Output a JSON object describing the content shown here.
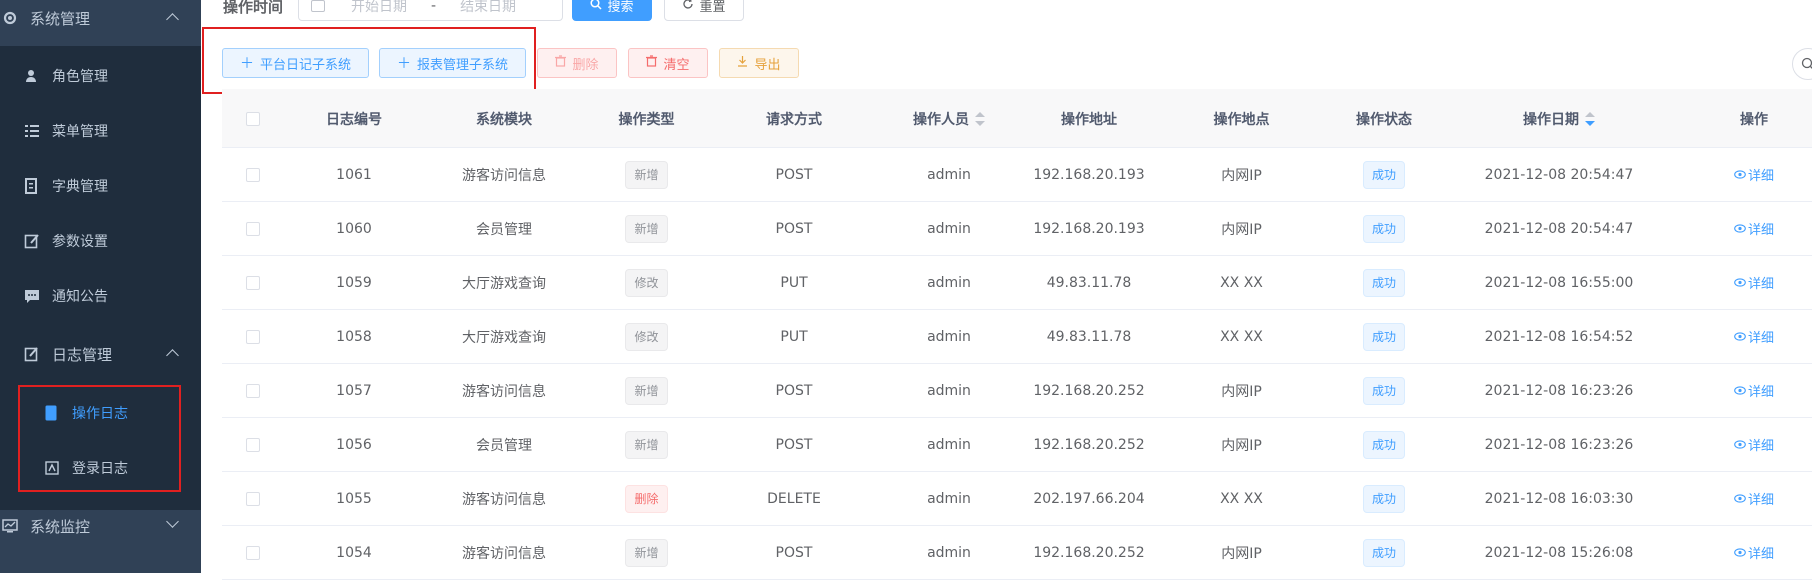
{
  "sidebar": {
    "system_label": "系统管理",
    "items": [
      {
        "label": "角色管理",
        "icon": "user-icon"
      },
      {
        "label": "菜单管理",
        "icon": "tree-table-icon"
      },
      {
        "label": "字典管理",
        "icon": "dict-icon"
      },
      {
        "label": "参数设置",
        "icon": "edit-icon"
      },
      {
        "label": "通知公告",
        "icon": "message-icon"
      }
    ],
    "log_menu_label": "日志管理",
    "log_items": [
      {
        "label": "操作日志",
        "active": true
      },
      {
        "label": "登录日志",
        "active": false
      }
    ],
    "monitor_label": "系统监控",
    "colors": {
      "bg": "#304156",
      "sub_bg": "#1f2d3d",
      "text": "#bfcbd9",
      "active": "#409eff"
    }
  },
  "search": {
    "label": "操作时间",
    "start_placeholder": "开始日期",
    "separator": "-",
    "end_placeholder": "结束日期",
    "search_button": "搜索",
    "reset_button": "重置"
  },
  "toolbar": {
    "platform_button": "平台日记子系统",
    "report_button": "报表管理子系统",
    "delete_button": "删除",
    "clear_button": "清空",
    "export_button": "导出"
  },
  "table": {
    "columns": [
      "日志编号",
      "系统模块",
      "操作类型",
      "请求方式",
      "操作人员",
      "操作地址",
      "操作地点",
      "操作状态",
      "操作日期",
      "操作"
    ],
    "detail_label": "详细",
    "rows": [
      {
        "id": "1061",
        "module": "游客访问信息",
        "type": "新增",
        "type_style": "info",
        "method": "POST",
        "user": "admin",
        "ip": "192.168.20.193",
        "location": "内网IP",
        "status": "成功",
        "date": "2021-12-08 20:54:47"
      },
      {
        "id": "1060",
        "module": "会员管理",
        "type": "新增",
        "type_style": "info",
        "method": "POST",
        "user": "admin",
        "ip": "192.168.20.193",
        "location": "内网IP",
        "status": "成功",
        "date": "2021-12-08 20:54:47"
      },
      {
        "id": "1059",
        "module": "大厅游戏查询",
        "type": "修改",
        "type_style": "info",
        "method": "PUT",
        "user": "admin",
        "ip": "49.83.11.78",
        "location": "XX XX",
        "status": "成功",
        "date": "2021-12-08 16:55:00"
      },
      {
        "id": "1058",
        "module": "大厅游戏查询",
        "type": "修改",
        "type_style": "info",
        "method": "PUT",
        "user": "admin",
        "ip": "49.83.11.78",
        "location": "XX XX",
        "status": "成功",
        "date": "2021-12-08 16:54:52"
      },
      {
        "id": "1057",
        "module": "游客访问信息",
        "type": "新增",
        "type_style": "info",
        "method": "POST",
        "user": "admin",
        "ip": "192.168.20.252",
        "location": "内网IP",
        "status": "成功",
        "date": "2021-12-08 16:23:26"
      },
      {
        "id": "1056",
        "module": "会员管理",
        "type": "新增",
        "type_style": "info",
        "method": "POST",
        "user": "admin",
        "ip": "192.168.20.252",
        "location": "内网IP",
        "status": "成功",
        "date": "2021-12-08 16:23:26"
      },
      {
        "id": "1055",
        "module": "游客访问信息",
        "type": "删除",
        "type_style": "danger",
        "method": "DELETE",
        "user": "admin",
        "ip": "202.197.66.204",
        "location": "XX XX",
        "status": "成功",
        "date": "2021-12-08 16:03:30"
      },
      {
        "id": "1054",
        "module": "游客访问信息",
        "type": "新增",
        "type_style": "info",
        "method": "POST",
        "user": "admin",
        "ip": "192.168.20.252",
        "location": "内网IP",
        "status": "成功",
        "date": "2021-12-08 15:26:08"
      }
    ]
  }
}
